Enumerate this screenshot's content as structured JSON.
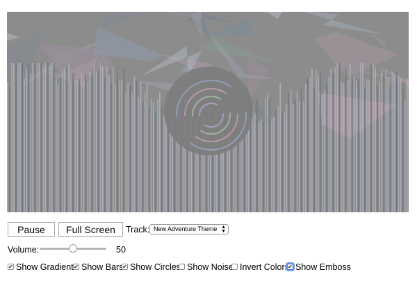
{
  "controls": {
    "pause_label": "Pause",
    "fullscreen_label": "Full Screen",
    "track_label": "Track:",
    "track_selected": "New Adventure Theme",
    "volume_label": "Volume:",
    "volume_value": "50",
    "volume_level": 0.5
  },
  "checkboxes": [
    {
      "label": "Show Gradient",
      "checked": true
    },
    {
      "label": "Show Bars",
      "checked": true
    },
    {
      "label": "Show Circles",
      "checked": true
    },
    {
      "label": "Show Noise",
      "checked": false
    },
    {
      "label": "Invert Colors",
      "checked": false
    },
    {
      "label": "Show Emboss",
      "checked": true,
      "focused": true
    }
  ],
  "colors": {
    "canvas_background": "#8c8c8c",
    "focus_ring": "#6f9ee8"
  }
}
